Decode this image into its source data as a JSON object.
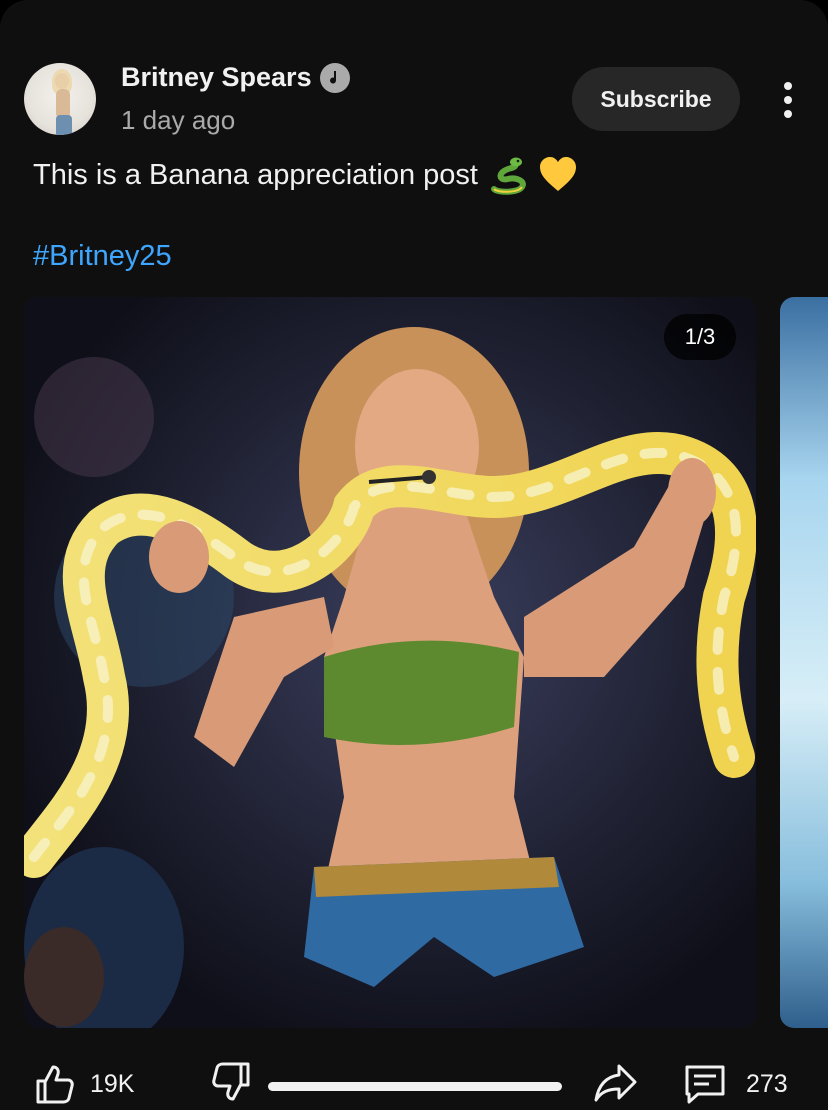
{
  "post": {
    "channel_name": "Britney Spears",
    "time": "1 day ago",
    "subscribe_label": "Subscribe",
    "text": "This is a Banana appreciation post",
    "emojis": [
      "snake-emoji",
      "yellow-heart-emoji"
    ],
    "hashtag": "#Britney25",
    "image_counter": "1/3"
  },
  "actions": {
    "like_count": "19K",
    "comment_count": "273"
  },
  "colors": {
    "background": "#0f0f0f",
    "hashtag": "#3ea6ff",
    "secondary_text": "#aaaaaa",
    "button_bg": "#272727"
  }
}
